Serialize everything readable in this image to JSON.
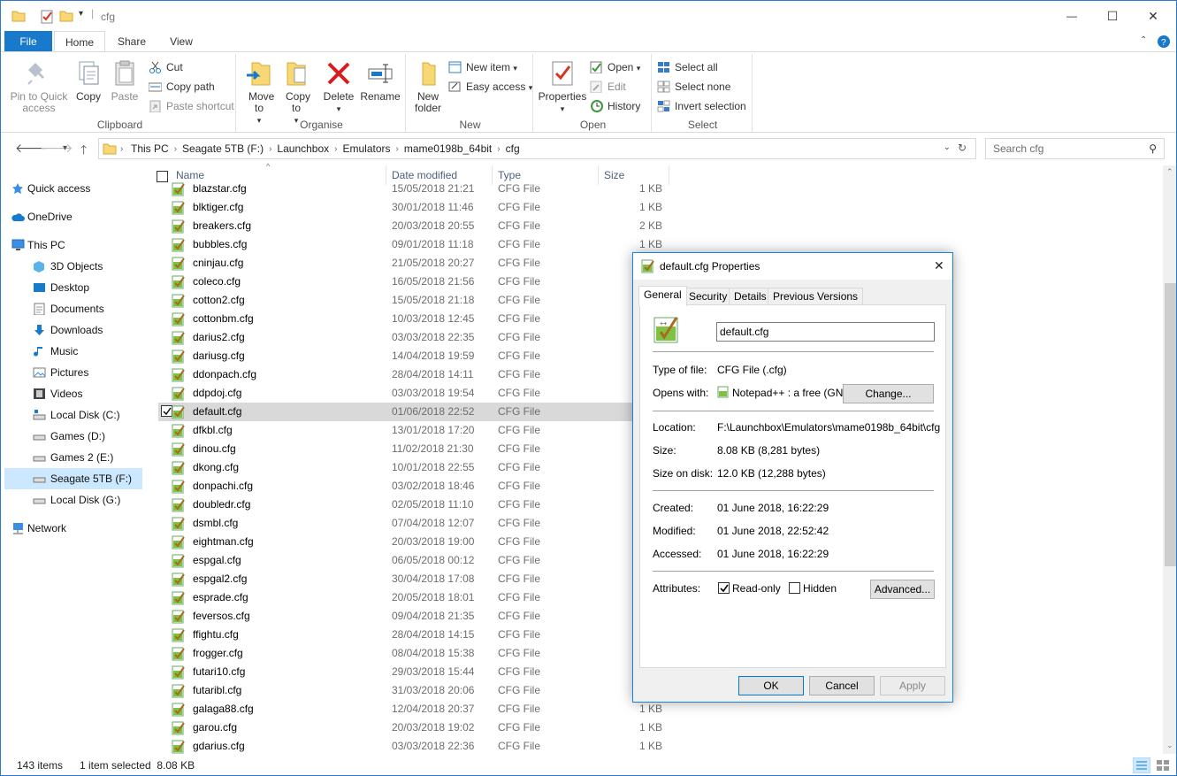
{
  "window": {
    "title": "cfg",
    "minimize_glyph": "—",
    "maximize_glyph": "☐",
    "close_glyph": "✕"
  },
  "ribbon_tabs": [
    "File",
    "Home",
    "Share",
    "View"
  ],
  "ribbon": {
    "clipboard": {
      "label": "Clipboard",
      "pin": "Pin to Quick access",
      "copy": "Copy",
      "paste": "Paste",
      "cut": "Cut",
      "copy_path": "Copy path",
      "paste_shortcut": "Paste shortcut"
    },
    "organise": {
      "label": "Organise",
      "move_to": "Move to",
      "copy_to": "Copy to",
      "delete": "Delete",
      "rename": "Rename"
    },
    "new": {
      "label": "New",
      "new_folder": "New folder",
      "new_item": "New item",
      "easy_access": "Easy access"
    },
    "open": {
      "label": "Open",
      "properties": "Properties",
      "open": "Open",
      "edit": "Edit",
      "history": "History"
    },
    "select": {
      "label": "Select",
      "select_all": "Select all",
      "select_none": "Select none",
      "invert": "Invert selection"
    }
  },
  "address": {
    "crumbs": [
      "This PC",
      "Seagate 5TB (F:)",
      "Launchbox",
      "Emulators",
      "mame0198b_64bit",
      "cfg"
    ],
    "search_placeholder": "Search cfg"
  },
  "nav": {
    "quick_access": "Quick access",
    "onedrive": "OneDrive",
    "this_pc": "This PC",
    "items": [
      "3D Objects",
      "Desktop",
      "Documents",
      "Downloads",
      "Music",
      "Pictures",
      "Videos",
      "Local Disk (C:)",
      "Games (D:)",
      "Games 2 (E:)",
      "Seagate 5TB (F:)",
      "Local Disk (G:)"
    ],
    "network": "Network"
  },
  "columns": {
    "name": "Name",
    "date": "Date modified",
    "type": "Type",
    "size": "Size"
  },
  "files": [
    {
      "name": "blazstar.cfg",
      "date": "15/05/2018 21:21",
      "type": "CFG File",
      "size": "1 KB"
    },
    {
      "name": "blktiger.cfg",
      "date": "30/01/2018 11:46",
      "type": "CFG File",
      "size": "1 KB"
    },
    {
      "name": "breakers.cfg",
      "date": "20/03/2018 20:55",
      "type": "CFG File",
      "size": "2 KB"
    },
    {
      "name": "bubbles.cfg",
      "date": "09/01/2018 11:18",
      "type": "CFG File",
      "size": "1 KB"
    },
    {
      "name": "cninjau.cfg",
      "date": "21/05/2018 20:27",
      "type": "CFG File",
      "size": ""
    },
    {
      "name": "coleco.cfg",
      "date": "16/05/2018 21:56",
      "type": "CFG File",
      "size": ""
    },
    {
      "name": "cotton2.cfg",
      "date": "15/05/2018 21:18",
      "type": "CFG File",
      "size": ""
    },
    {
      "name": "cottonbm.cfg",
      "date": "10/03/2018 12:45",
      "type": "CFG File",
      "size": ""
    },
    {
      "name": "darius2.cfg",
      "date": "03/03/2018 22:35",
      "type": "CFG File",
      "size": ""
    },
    {
      "name": "dariusg.cfg",
      "date": "14/04/2018 19:59",
      "type": "CFG File",
      "size": ""
    },
    {
      "name": "ddonpach.cfg",
      "date": "28/04/2018 14:11",
      "type": "CFG File",
      "size": ""
    },
    {
      "name": "ddpdoj.cfg",
      "date": "03/03/2018 19:54",
      "type": "CFG File",
      "size": ""
    },
    {
      "name": "default.cfg",
      "date": "01/06/2018 22:52",
      "type": "CFG File",
      "size": ""
    },
    {
      "name": "dfkbl.cfg",
      "date": "13/01/2018 17:20",
      "type": "CFG File",
      "size": ""
    },
    {
      "name": "dinou.cfg",
      "date": "11/02/2018 21:30",
      "type": "CFG File",
      "size": ""
    },
    {
      "name": "dkong.cfg",
      "date": "10/01/2018 22:55",
      "type": "CFG File",
      "size": ""
    },
    {
      "name": "donpachi.cfg",
      "date": "03/02/2018 18:46",
      "type": "CFG File",
      "size": ""
    },
    {
      "name": "doubledr.cfg",
      "date": "02/05/2018 11:10",
      "type": "CFG File",
      "size": ""
    },
    {
      "name": "dsmbl.cfg",
      "date": "07/04/2018 12:07",
      "type": "CFG File",
      "size": ""
    },
    {
      "name": "eightman.cfg",
      "date": "20/03/2018 19:00",
      "type": "CFG File",
      "size": ""
    },
    {
      "name": "espgal.cfg",
      "date": "06/05/2018 00:12",
      "type": "CFG File",
      "size": ""
    },
    {
      "name": "espgal2.cfg",
      "date": "30/04/2018 17:08",
      "type": "CFG File",
      "size": ""
    },
    {
      "name": "esprade.cfg",
      "date": "20/05/2018 18:01",
      "type": "CFG File",
      "size": ""
    },
    {
      "name": "feversos.cfg",
      "date": "09/04/2018 21:35",
      "type": "CFG File",
      "size": ""
    },
    {
      "name": "ffightu.cfg",
      "date": "28/04/2018 14:15",
      "type": "CFG File",
      "size": ""
    },
    {
      "name": "frogger.cfg",
      "date": "08/04/2018 15:38",
      "type": "CFG File",
      "size": ""
    },
    {
      "name": "futari10.cfg",
      "date": "29/03/2018 15:44",
      "type": "CFG File",
      "size": ""
    },
    {
      "name": "futaribl.cfg",
      "date": "31/03/2018 20:06",
      "type": "CFG File",
      "size": ""
    },
    {
      "name": "galaga88.cfg",
      "date": "12/04/2018 20:37",
      "type": "CFG File",
      "size": "1 KB"
    },
    {
      "name": "garou.cfg",
      "date": "20/03/2018 19:02",
      "type": "CFG File",
      "size": "1 KB"
    },
    {
      "name": "gdarius.cfg",
      "date": "03/03/2018 22:36",
      "type": "CFG File",
      "size": "1 KB"
    }
  ],
  "status": {
    "count": "143 items",
    "selected": "1 item selected  8.08 KB"
  },
  "dialog": {
    "title": "default.cfg Properties",
    "tabs": [
      "General",
      "Security",
      "Details",
      "Previous Versions"
    ],
    "filename": "default.cfg",
    "type_label": "Type of file:",
    "type_value": "CFG File (.cfg)",
    "opens_label": "Opens with:",
    "opens_value": "Notepad++ : a free (GN",
    "change_btn": "Change...",
    "location_label": "Location:",
    "location_value": "F:\\Launchbox\\Emulators\\mame0198b_64bit\\cfg",
    "size_label": "Size:",
    "size_value": "8.08 KB (8,281 bytes)",
    "disk_label": "Size on disk:",
    "disk_value": "12.0 KB (12,288 bytes)",
    "created_label": "Created:",
    "created_value": "01 June 2018, 16:22:29",
    "modified_label": "Modified:",
    "modified_value": "01 June 2018, 22:52:42",
    "accessed_label": "Accessed:",
    "accessed_value": "01 June 2018, 16:22:29",
    "attr_label": "Attributes:",
    "readonly": "Read-only",
    "hidden": "Hidden",
    "advanced_btn": "Advanced...",
    "ok": "OK",
    "cancel": "Cancel",
    "apply": "Apply"
  }
}
